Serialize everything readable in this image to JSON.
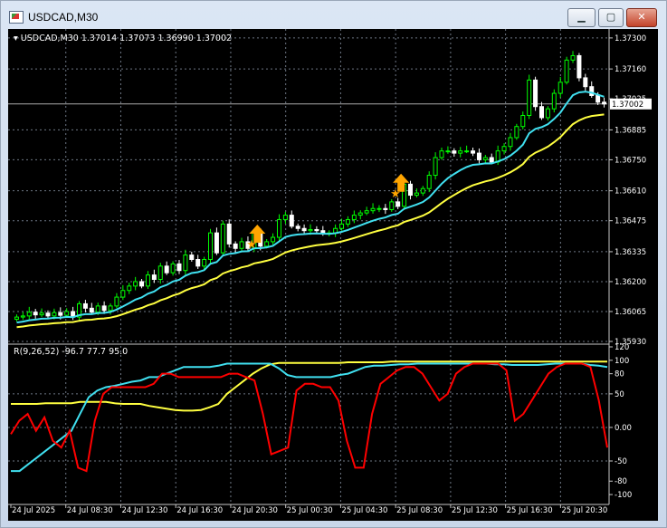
{
  "window": {
    "title": "USDCAD,M30",
    "buttons": {
      "minimize": "▁",
      "maximize": "▢",
      "close": "✕"
    }
  },
  "chart_info": {
    "label": "▾ USDCAD,M30  1.37014  1.37073  1.36990  1.37002",
    "current_price": "1.37002"
  },
  "price_axis": {
    "ticks": [
      {
        "label": "1.37300",
        "value": 1.373
      },
      {
        "label": "1.37160",
        "value": 1.3716
      },
      {
        "label": "1.37025",
        "value": 1.37025
      },
      {
        "label": "1.36885",
        "value": 1.36885
      },
      {
        "label": "1.36750",
        "value": 1.3675
      },
      {
        "label": "1.36610",
        "value": 1.3661
      },
      {
        "label": "1.36475",
        "value": 1.36475
      },
      {
        "label": "1.36335",
        "value": 1.36335
      },
      {
        "label": "1.36200",
        "value": 1.362
      },
      {
        "label": "1.36065",
        "value": 1.36065
      },
      {
        "label": "1.35930",
        "value": 1.3593
      }
    ],
    "range": [
      1.3593,
      1.3732
    ]
  },
  "indicator": {
    "label": "R(9,26,52)  -96.7  77.7  95.0",
    "ticks": [
      {
        "label": "120",
        "value": 120
      },
      {
        "label": "100",
        "value": 100
      },
      {
        "label": "80",
        "value": 80
      },
      {
        "label": "50",
        "value": 50
      },
      {
        "label": "0.00",
        "value": 0
      },
      {
        "label": "-50",
        "value": -50
      },
      {
        "label": "-80",
        "value": -80
      },
      {
        "label": "-100",
        "value": -100
      }
    ],
    "range": [
      -108,
      120
    ]
  },
  "time_axis": {
    "labels": [
      "24 Jul 2025",
      "24 Jul 08:30",
      "24 Jul 12:30",
      "24 Jul 16:30",
      "24 Jul 20:30",
      "25 Jul 00:30",
      "25 Jul 04:30",
      "25 Jul 08:30",
      "25 Jul 12:30",
      "25 Jul 16:30",
      "25 Jul 20:30"
    ]
  },
  "colors": {
    "background": "#000000",
    "grid": "#6e7785",
    "bull_candle": "#00ff00",
    "bear_candle": "#ffffff",
    "ma_fast": "#40e0f0",
    "ma_slow": "#ffff40",
    "signal_arrow": "#ffa500",
    "osc_red": "#ff0000",
    "osc_cyan": "#40e0f0",
    "osc_yellow": "#ffff40",
    "price_label_bg": "#ffffff"
  },
  "chart_data": {
    "type": "candlestick",
    "series": [
      {
        "name": "close",
        "values": [
          1.3604,
          1.36045,
          1.36062,
          1.3605,
          1.36058,
          1.36045,
          1.3606,
          1.36048,
          1.36065,
          1.3604,
          1.361,
          1.3608,
          1.36062,
          1.3609,
          1.3607,
          1.3609,
          1.3613,
          1.3616,
          1.3618,
          1.362,
          1.3618,
          1.3623,
          1.3621,
          1.3627,
          1.3624,
          1.3628,
          1.3625,
          1.3632,
          1.363,
          1.3627,
          1.363,
          1.3642,
          1.3633,
          1.3646,
          1.3637,
          1.3635,
          1.3638,
          1.3635,
          1.3642,
          1.3636,
          1.3638,
          1.364,
          1.3648,
          1.365,
          1.3645,
          1.3644,
          1.3643,
          1.36435,
          1.3643,
          1.3642,
          1.3642,
          1.3644,
          1.3646,
          1.3648,
          1.365,
          1.3651,
          1.3652,
          1.3653,
          1.3653,
          1.36525,
          1.3656,
          1.3654,
          1.3664,
          1.3659,
          1.366,
          1.3662,
          1.3668,
          1.3676,
          1.3679,
          1.3679,
          1.3678,
          1.3679,
          1.3679,
          1.3678,
          1.3675,
          1.3676,
          1.3674,
          1.3679,
          1.3681,
          1.3685,
          1.369,
          1.3695,
          1.3711,
          1.3699,
          1.3694,
          1.3698,
          1.3705,
          1.371,
          1.372,
          1.3722,
          1.3712,
          1.3708,
          1.3704,
          1.3701,
          1.37002
        ]
      },
      {
        "name": "fast MA",
        "values": []
      },
      {
        "name": "slow MA",
        "values": []
      }
    ],
    "oscillator": {
      "label": "R(9,26,52)",
      "red": [
        -10,
        10,
        20,
        -5,
        15,
        -20,
        -30,
        -5,
        -60,
        -65,
        10,
        50,
        60,
        60,
        60,
        60,
        60,
        65,
        80,
        80,
        75,
        75,
        75,
        75,
        75,
        75,
        80,
        80,
        75,
        70,
        20,
        -40,
        -35,
        -30,
        55,
        65,
        65,
        60,
        60,
        40,
        -20,
        -60,
        -60,
        20,
        65,
        75,
        85,
        90,
        90,
        80,
        60,
        40,
        50,
        80,
        90,
        95,
        95,
        95,
        95,
        85,
        10,
        20,
        40,
        60,
        80,
        90,
        95,
        95,
        95,
        90,
        40,
        -30
      ],
      "cyan": [
        -65,
        -65,
        -55,
        -45,
        -35,
        -25,
        -15,
        -5,
        20,
        45,
        55,
        60,
        62,
        65,
        68,
        70,
        75,
        75,
        80,
        85,
        90,
        90,
        90,
        90,
        92,
        95,
        95,
        95,
        95,
        95,
        95,
        88,
        78,
        75,
        75,
        75,
        75,
        75,
        78,
        80,
        85,
        90,
        92,
        92,
        93,
        94,
        94,
        95,
        95,
        95,
        95,
        95,
        95,
        95,
        95,
        95,
        94,
        94,
        93,
        93,
        93,
        93,
        94,
        95,
        95,
        95,
        95,
        93,
        92,
        90
      ],
      "yellow": [
        35,
        35,
        35,
        35,
        36,
        36,
        36,
        36,
        38,
        38,
        38,
        38,
        36,
        35,
        35,
        35,
        32,
        30,
        28,
        26,
        25,
        25,
        26,
        30,
        35,
        50,
        60,
        70,
        80,
        88,
        94,
        96,
        96,
        96,
        96,
        96,
        96,
        96,
        96,
        97,
        97,
        97,
        97,
        97,
        98,
        98,
        98,
        98,
        98,
        98,
        98,
        98,
        98,
        98,
        98,
        98,
        98,
        98,
        98,
        98,
        98,
        98,
        98,
        98,
        98,
        98,
        98,
        98,
        98,
        98
      ]
    }
  }
}
